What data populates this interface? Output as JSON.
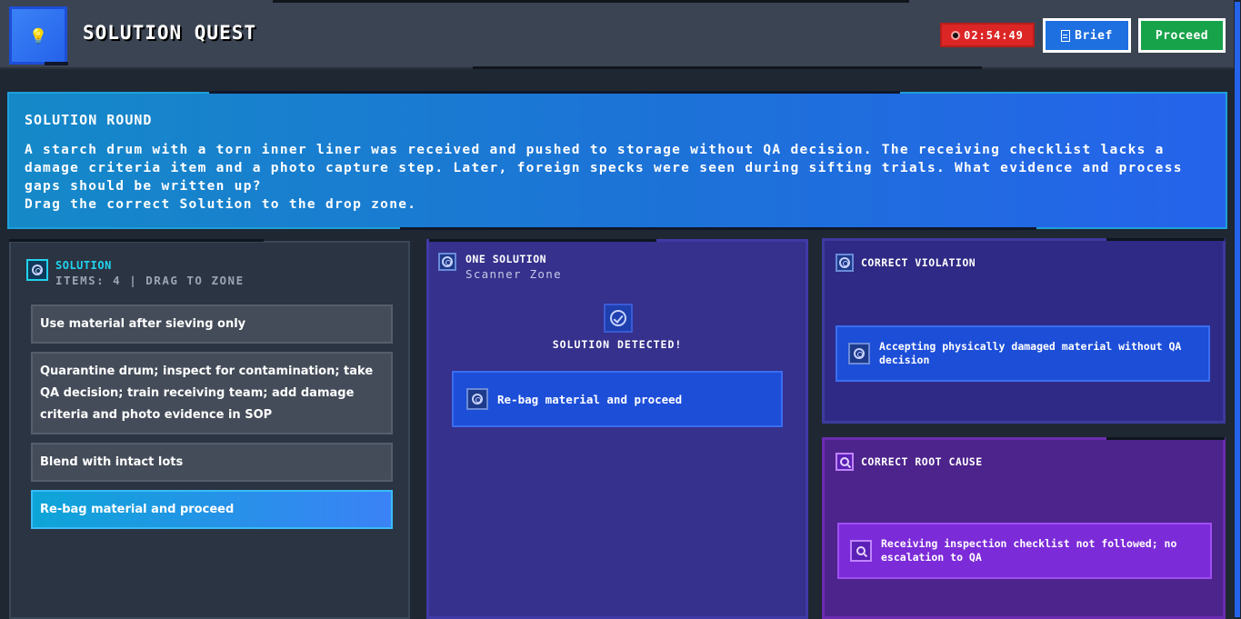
{
  "header": {
    "title": "SOLUTION QUEST",
    "logo_icon": "lightbulb-icon",
    "timer": "02:54:49",
    "brief_label": "Brief",
    "proceed_label": "Proceed"
  },
  "round": {
    "title": "SOLUTION ROUND",
    "question": "A starch drum with a torn inner liner was received and pushed to storage without QA decision. The receiving checklist lacks a damage criteria item and a photo capture step. Later, foreign specks were seen during sifting trials. What evidence and process gaps should be written up?",
    "instruction": "Drag the correct Solution to the drop zone."
  },
  "solution_panel": {
    "title": "SOLUTION",
    "subtitle": "ITEMS: 4 | DRAG TO ZONE",
    "items": [
      {
        "label": "Use material after sieving only"
      },
      {
        "label": "Quarantine drum; inspect for contamination; take QA decision; train receiving team; add damage criteria and photo evidence in SOP"
      },
      {
        "label": "Blend with intact lots"
      },
      {
        "label": "Re-bag material and proceed"
      }
    ]
  },
  "zone_panel": {
    "title": "ONE SOLUTION",
    "subtitle": "Scanner Zone",
    "status": "SOLUTION DETECTED!",
    "dropped_item": "Re-bag material and proceed"
  },
  "violation_panel": {
    "title": "CORRECT VIOLATION",
    "card": "Accepting physically damaged material without QA decision"
  },
  "root_cause_panel": {
    "title": "CORRECT ROOT CAUSE",
    "card": "Receiving inspection checklist not followed; no escalation to QA"
  },
  "colors": {
    "background": "#1f2733",
    "accent_blue": "#2563eb",
    "timer_red": "#dc2626",
    "proceed_green": "#16a34a",
    "cyan": "#22d3ee",
    "purple": "#7c2bd9"
  }
}
